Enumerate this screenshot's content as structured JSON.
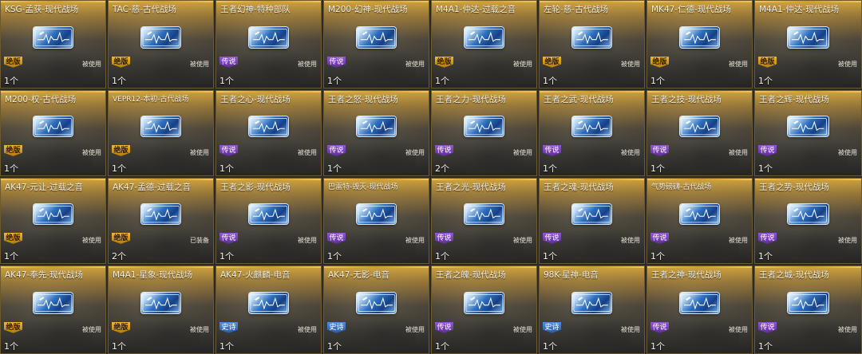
{
  "icons": {
    "card": "weapon-skin-card-icon"
  },
  "colors": {
    "gold": "#f2b62c",
    "purple": "#7a3fc0",
    "blue": "#3a74c8",
    "tile_top": "#d6a83e"
  },
  "items": [
    {
      "name": "KSG-孟获-现代战场",
      "badge": "绝版",
      "tier": "gold",
      "status": "被使用",
      "count": "1个"
    },
    {
      "name": "TAC-慈-古代战场",
      "badge": "绝版",
      "tier": "gold",
      "status": "被使用",
      "count": "1个"
    },
    {
      "name": "王者幻神-特种部队",
      "badge": "传说",
      "tier": "purple",
      "status": "被使用",
      "count": "1个"
    },
    {
      "name": "M200-幻神-现代战场",
      "badge": "传说",
      "tier": "purple",
      "status": "被使用",
      "count": "1个"
    },
    {
      "name": "M4A1-仲达-过载之音",
      "badge": "绝版",
      "tier": "gold",
      "status": "被使用",
      "count": "1个"
    },
    {
      "name": "左轮-慈-古代战场",
      "badge": "绝版",
      "tier": "gold",
      "status": "被使用",
      "count": "1个"
    },
    {
      "name": "MK47-仁德-现代战场",
      "badge": "绝版",
      "tier": "gold",
      "status": "被使用",
      "count": "1个"
    },
    {
      "name": "M4A1-仲达-现代战场",
      "badge": "绝版",
      "tier": "gold",
      "status": "被使用",
      "count": "1个"
    },
    {
      "name": "M200-权-古代战场",
      "badge": "绝版",
      "tier": "gold",
      "status": "被使用",
      "count": "1个"
    },
    {
      "name": "VEPR12-本初-古代战场",
      "badge": "绝版",
      "tier": "gold",
      "status": "被使用",
      "count": "1个",
      "small": true
    },
    {
      "name": "王者之心-现代战场",
      "badge": "传说",
      "tier": "purple",
      "status": "被使用",
      "count": "1个"
    },
    {
      "name": "王者之怒-现代战场",
      "badge": "传说",
      "tier": "purple",
      "status": "被使用",
      "count": "1个"
    },
    {
      "name": "王者之力-现代战场",
      "badge": "传说",
      "tier": "purple",
      "status": "被使用",
      "count": "2个"
    },
    {
      "name": "王者之武-现代战场",
      "badge": "传说",
      "tier": "purple",
      "status": "被使用",
      "count": "1个"
    },
    {
      "name": "王者之技-现代战场",
      "badge": "传说",
      "tier": "purple",
      "status": "被使用",
      "count": "1个"
    },
    {
      "name": "王者之辉-现代战场",
      "badge": "传说",
      "tier": "purple",
      "status": "被使用",
      "count": "1个"
    },
    {
      "name": "AK47-元让-过载之音",
      "badge": "绝版",
      "tier": "gold",
      "status": "被使用",
      "count": "1个"
    },
    {
      "name": "AK47-孟德-过载之音",
      "badge": "绝版",
      "tier": "gold",
      "status": "已装备",
      "count": "2个"
    },
    {
      "name": "王者之影-现代战场",
      "badge": "传说",
      "tier": "purple",
      "status": "被使用",
      "count": "1个"
    },
    {
      "name": "巴雷特-毁灭-现代战场",
      "badge": "传说",
      "tier": "purple",
      "status": "被使用",
      "count": "1个",
      "small": true
    },
    {
      "name": "王者之光-现代战场",
      "badge": "传说",
      "tier": "purple",
      "status": "被使用",
      "count": "1个"
    },
    {
      "name": "王者之魂-现代战场",
      "badge": "传说",
      "tier": "purple",
      "status": "被使用",
      "count": "1个"
    },
    {
      "name": "气势磅礴-古代战场",
      "badge": "传说",
      "tier": "purple",
      "status": "被使用",
      "count": "1个",
      "small": true
    },
    {
      "name": "王者之势-现代战场",
      "badge": "传说",
      "tier": "purple",
      "status": "被使用",
      "count": "1个"
    },
    {
      "name": "AK47-奉先-现代战场",
      "badge": "绝版",
      "tier": "gold",
      "status": "被使用",
      "count": "1个"
    },
    {
      "name": "M4A1-星象-现代战场",
      "badge": "绝版",
      "tier": "gold",
      "status": "被使用",
      "count": "1个"
    },
    {
      "name": "AK47-火麒麟-电音",
      "badge": "史诗",
      "tier": "blue",
      "status": "被使用",
      "count": "1个"
    },
    {
      "name": "AK47-无影-电音",
      "badge": "史诗",
      "tier": "blue",
      "status": "被使用",
      "count": "1个"
    },
    {
      "name": "王者之魄-现代战场",
      "badge": "传说",
      "tier": "purple",
      "status": "被使用",
      "count": "1个"
    },
    {
      "name": "98K-星神-电音",
      "badge": "史诗",
      "tier": "blue",
      "status": "被使用",
      "count": "1个"
    },
    {
      "name": "王者之神-现代战场",
      "badge": "传说",
      "tier": "purple",
      "status": "被使用",
      "count": "1个"
    },
    {
      "name": "王者之城-现代战场",
      "badge": "传说",
      "tier": "purple",
      "status": "被使用",
      "count": "1个"
    }
  ]
}
